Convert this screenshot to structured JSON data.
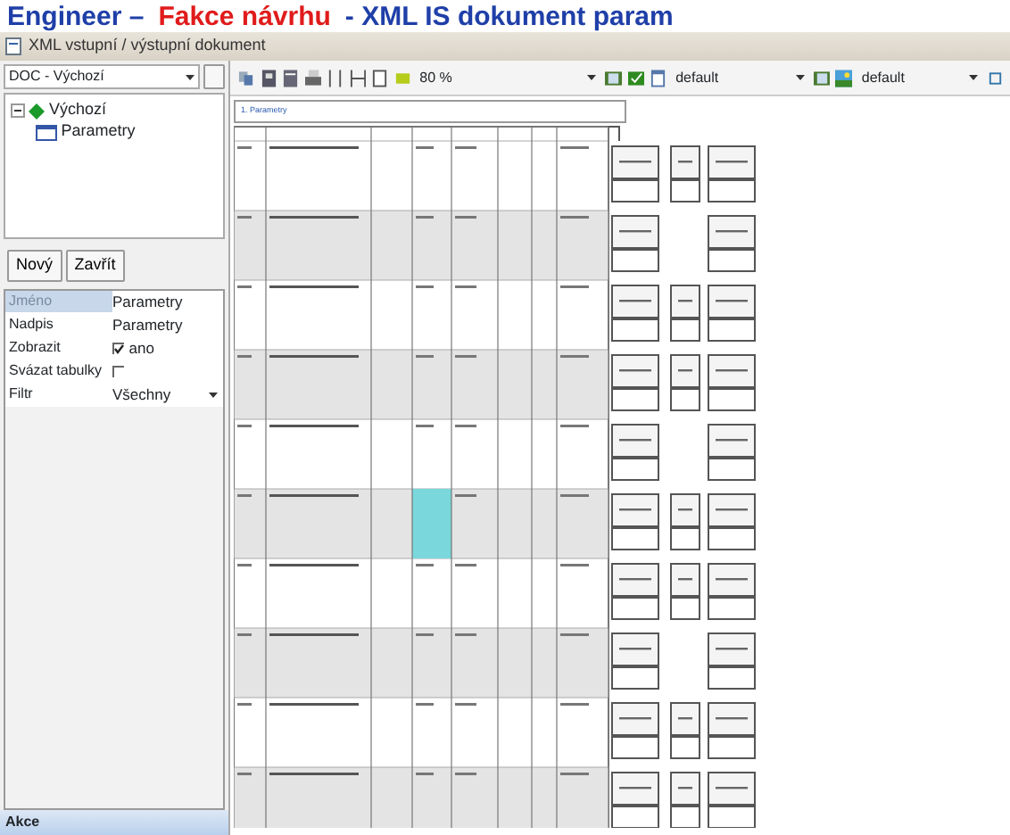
{
  "banner": [
    {
      "text": "Engineer –",
      "color": "#1f3fa8"
    },
    {
      "text": "Fakce návrhu",
      "color": "#e01b1b"
    },
    {
      "text": "- XML IS dokument param",
      "color": "#1f3fa8"
    }
  ],
  "window": {
    "title": "XML vstupní / výstupní dokument"
  },
  "document_selector": {
    "value": "DOC - Výchozí"
  },
  "tree": [
    {
      "label": "Výchozí",
      "expanded": true,
      "children": [
        {
          "label": "Parametry"
        }
      ]
    }
  ],
  "buttons": [
    "Nový",
    "Zavřít"
  ],
  "properties": [
    {
      "kind": "text",
      "name": "Jméno",
      "value": "Parametry",
      "selected": true
    },
    {
      "kind": "text",
      "name": "Nadpis",
      "value": "Parametry",
      "selected": false
    },
    {
      "kind": "checkbox",
      "name": "Zobrazit",
      "value": "ano",
      "checked": true,
      "selected": false
    },
    {
      "kind": "checkbox",
      "name": "Svázat tabulky",
      "checked": false,
      "selected": false
    },
    {
      "kind": "dropdown",
      "name": "Filtr",
      "value": "Všechny",
      "selected": false
    }
  ],
  "toolbar": {
    "zoom": "80 %",
    "style_1": "default",
    "style_2": "default"
  },
  "document": {
    "heading": "1. Parametry"
  },
  "status_bar": "Akce"
}
